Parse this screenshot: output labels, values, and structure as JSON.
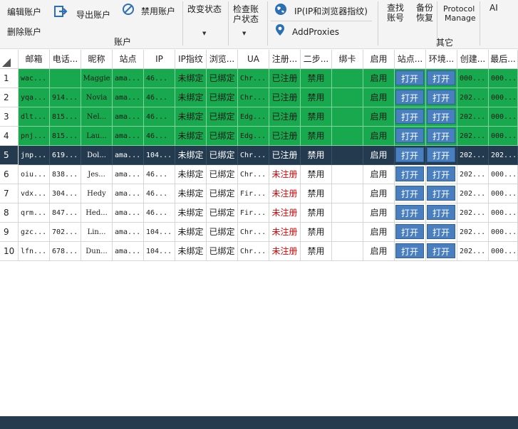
{
  "ribbon": {
    "edit_account": "编辑账户",
    "delete_account": "删除账户",
    "export_account": "导出账户",
    "ban_account": "禁用账户",
    "account_group": "账户",
    "change_status": "改变状态",
    "check_status_line1": "检查账",
    "check_status_line2": "户状态",
    "ip_fingerprint": "IP(IP和浏览器指纹)",
    "add_proxies": "AddProxies",
    "find_line1": "查找",
    "find_line2": "账号",
    "backup_line1": "备份",
    "backup_line2": "恢复",
    "protocol_line1": "Protocol",
    "protocol_line2": "Manage",
    "ai": "AI",
    "other_group": "其它"
  },
  "table": {
    "headers": [
      "邮箱",
      "电话...",
      "昵称",
      "站点",
      "IP",
      "IP指纹",
      "浏览...",
      "UA",
      "注册...",
      "二步...",
      "绑卡",
      "启用",
      "站点...",
      "环境...",
      "创建...",
      "最后..."
    ],
    "rows": [
      {
        "num": "1",
        "style": "green",
        "email": "wac...",
        "phone": "",
        "nick": "Maggie",
        "site": "ama...",
        "ip": "46...",
        "ipfp": "未绑定",
        "browser": "已绑定",
        "ua": "Chr...",
        "reg": "已注册",
        "reg_red": false,
        "twostep": "禁用",
        "card": "",
        "enable": "启用",
        "open1": "打开",
        "open2": "打开",
        "created": "000...",
        "last": "000..."
      },
      {
        "num": "2",
        "style": "green",
        "email": "yqa...",
        "phone": "914...",
        "nick": "Novia",
        "site": "ama...",
        "ip": "46...",
        "ipfp": "未绑定",
        "browser": "已绑定",
        "ua": "Chr...",
        "reg": "已注册",
        "reg_red": false,
        "twostep": "禁用",
        "card": "",
        "enable": "启用",
        "open1": "打开",
        "open2": "打开",
        "created": "202...",
        "last": "000..."
      },
      {
        "num": "3",
        "style": "green",
        "email": "dlt...",
        "phone": "815...",
        "nick": "Nel...",
        "site": "ama...",
        "ip": "46...",
        "ipfp": "未绑定",
        "browser": "已绑定",
        "ua": "Edg...",
        "reg": "已注册",
        "reg_red": false,
        "twostep": "禁用",
        "card": "",
        "enable": "启用",
        "open1": "打开",
        "open2": "打开",
        "created": "202...",
        "last": "000..."
      },
      {
        "num": "4",
        "style": "green",
        "email": "pnj...",
        "phone": "815...",
        "nick": "Lau...",
        "site": "ama...",
        "ip": "46...",
        "ipfp": "未绑定",
        "browser": "已绑定",
        "ua": "Edg...",
        "reg": "已注册",
        "reg_red": false,
        "twostep": "禁用",
        "card": "",
        "enable": "启用",
        "open1": "打开",
        "open2": "打开",
        "created": "202...",
        "last": "000..."
      },
      {
        "num": "5",
        "style": "dark",
        "email": "jnp...",
        "phone": "619...",
        "nick": "Dol...",
        "site": "ama...",
        "ip": "104...",
        "ipfp": "未绑定",
        "browser": "已绑定",
        "ua": "Chr...",
        "reg": "已注册",
        "reg_red": false,
        "twostep": "禁用",
        "card": "",
        "enable": "启用",
        "open1": "打开",
        "open2": "打开",
        "created": "202...",
        "last": "202..."
      },
      {
        "num": "6",
        "style": "white",
        "email": "oiu...",
        "phone": "838...",
        "nick": "Jes...",
        "site": "ama...",
        "ip": "46...",
        "ipfp": "未绑定",
        "browser": "已绑定",
        "ua": "Chr...",
        "reg": "未注册",
        "reg_red": true,
        "twostep": "禁用",
        "card": "",
        "enable": "启用",
        "open1": "打开",
        "open2": "打开",
        "created": "202...",
        "last": "000..."
      },
      {
        "num": "7",
        "style": "white",
        "email": "vdx...",
        "phone": "304...",
        "nick": "Hedy",
        "site": "ama...",
        "ip": "46...",
        "ipfp": "未绑定",
        "browser": "已绑定",
        "ua": "Fir...",
        "reg": "未注册",
        "reg_red": true,
        "twostep": "禁用",
        "card": "",
        "enable": "启用",
        "open1": "打开",
        "open2": "打开",
        "created": "202...",
        "last": "000..."
      },
      {
        "num": "8",
        "style": "white",
        "email": "qrm...",
        "phone": "847...",
        "nick": "Hed...",
        "site": "ama...",
        "ip": "46...",
        "ipfp": "未绑定",
        "browser": "已绑定",
        "ua": "Fir...",
        "reg": "未注册",
        "reg_red": true,
        "twostep": "禁用",
        "card": "",
        "enable": "启用",
        "open1": "打开",
        "open2": "打开",
        "created": "202...",
        "last": "000..."
      },
      {
        "num": "9",
        "style": "white",
        "email": "gzc...",
        "phone": "702...",
        "nick": "Lin...",
        "site": "ama...",
        "ip": "104...",
        "ipfp": "未绑定",
        "browser": "已绑定",
        "ua": "Chr...",
        "reg": "未注册",
        "reg_red": true,
        "twostep": "禁用",
        "card": "",
        "enable": "启用",
        "open1": "打开",
        "open2": "打开",
        "created": "202...",
        "last": "000..."
      },
      {
        "num": "10",
        "style": "white",
        "email": "lfn...",
        "phone": "678...",
        "nick": "Dun...",
        "site": "ama...",
        "ip": "104...",
        "ipfp": "未绑定",
        "browser": "已绑定",
        "ua": "Chr...",
        "reg": "未注册",
        "reg_red": true,
        "twostep": "禁用",
        "card": "",
        "enable": "启用",
        "open1": "打开",
        "open2": "打开",
        "created": "202...",
        "last": "000..."
      }
    ]
  },
  "colors": {
    "row_green": "#18a94e",
    "row_selected": "#243a4e",
    "open_button": "#4a7fbf",
    "unregistered_text": "#e00000"
  },
  "icons": {
    "export": "export-arrow-icon",
    "ban": "ban-circle-icon",
    "ip": "globe-icon",
    "proxy": "location-pin-icon"
  }
}
